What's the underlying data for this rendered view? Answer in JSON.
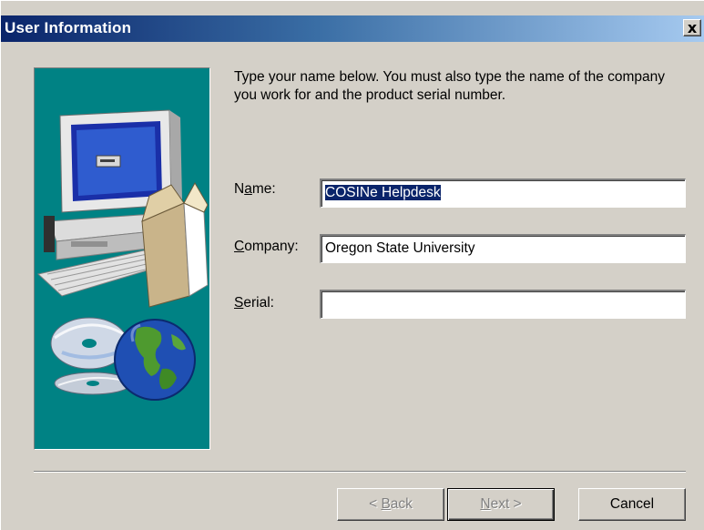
{
  "window": {
    "title": "User Information",
    "close_glyph": "x"
  },
  "instructions": "Type your name below. You must also type the name of the company you work for and the product serial number.",
  "fields": {
    "name": {
      "label_pre": "N",
      "label_key": "a",
      "label_post": "me:",
      "value": "COSINe Helpdesk"
    },
    "company": {
      "label_pre": "",
      "label_key": "C",
      "label_post": "ompany:",
      "value": "Oregon State University"
    },
    "serial": {
      "label_pre": "",
      "label_key": "S",
      "label_post": "erial:",
      "value": ""
    }
  },
  "buttons": {
    "back": {
      "prefix": "< ",
      "key": "B",
      "rest": "ack",
      "enabled": false
    },
    "next": {
      "key": "N",
      "rest": "ext >",
      "enabled": false
    },
    "cancel": {
      "label": "Cancel",
      "enabled": true
    }
  },
  "colors": {
    "title_gradient_start": "#0a246a",
    "title_gradient_end": "#a6caf0",
    "dialog_face": "#d4d0c8",
    "art_background": "#008284",
    "selection": "#0a246a"
  },
  "icons": [
    "close-icon",
    "computer-illustration",
    "cd-discs-icon",
    "globe-icon",
    "software-box-icon"
  ]
}
